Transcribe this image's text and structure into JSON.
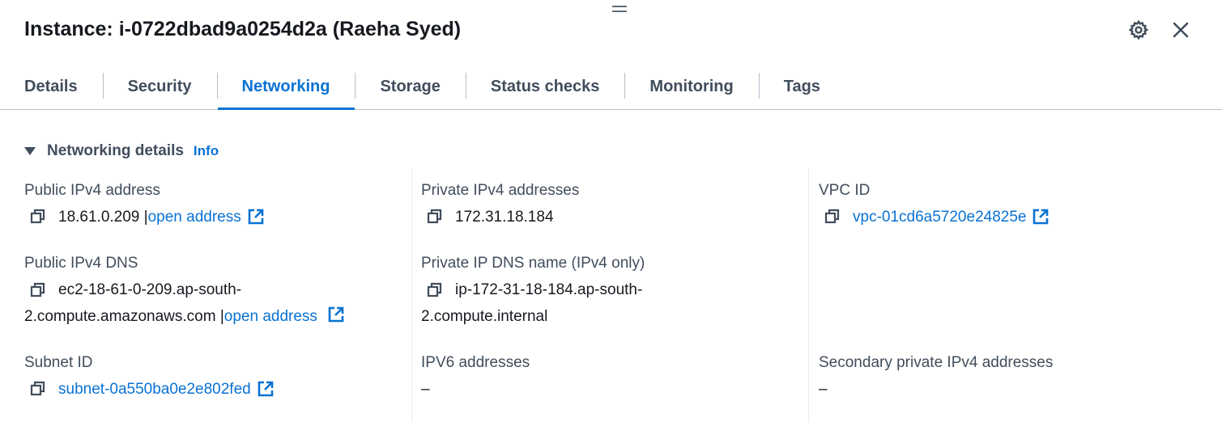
{
  "header": {
    "title": "Instance: i-0722dbad9a0254d2a (Raeha Syed)"
  },
  "tabs": [
    {
      "label": "Details"
    },
    {
      "label": "Security"
    },
    {
      "label": "Networking"
    },
    {
      "label": "Storage"
    },
    {
      "label": "Status checks"
    },
    {
      "label": "Monitoring"
    },
    {
      "label": "Tags"
    }
  ],
  "active_tab": "Networking",
  "section": {
    "title": "Networking details",
    "info": "Info"
  },
  "fields": {
    "public_ipv4": {
      "label": "Public IPv4 address",
      "value": "18.61.0.209 |",
      "link": "open address"
    },
    "public_dns": {
      "label": "Public IPv4 DNS",
      "value_line1": "ec2-18-61-0-209.ap-south-",
      "value_line2": "2.compute.amazonaws.com |",
      "link": "open address"
    },
    "subnet_id": {
      "label": "Subnet ID",
      "value": "subnet-0a550ba0e2e802fed"
    },
    "private_ipv4": {
      "label": "Private IPv4 addresses",
      "value": "172.31.18.184"
    },
    "private_dns": {
      "label": "Private IP DNS name (IPv4 only)",
      "value_line1": "ip-172-31-18-184.ap-south-",
      "value_line2": "2.compute.internal"
    },
    "ipv6": {
      "label": "IPV6 addresses",
      "value": "–"
    },
    "vpc_id": {
      "label": "VPC ID",
      "value": "vpc-01cd6a5720e24825e"
    },
    "secondary_private": {
      "label": "Secondary private IPv4 addresses",
      "value": "–"
    }
  },
  "colors": {
    "link": "#0972d3",
    "text": "#16191f",
    "label": "#414d5c"
  }
}
